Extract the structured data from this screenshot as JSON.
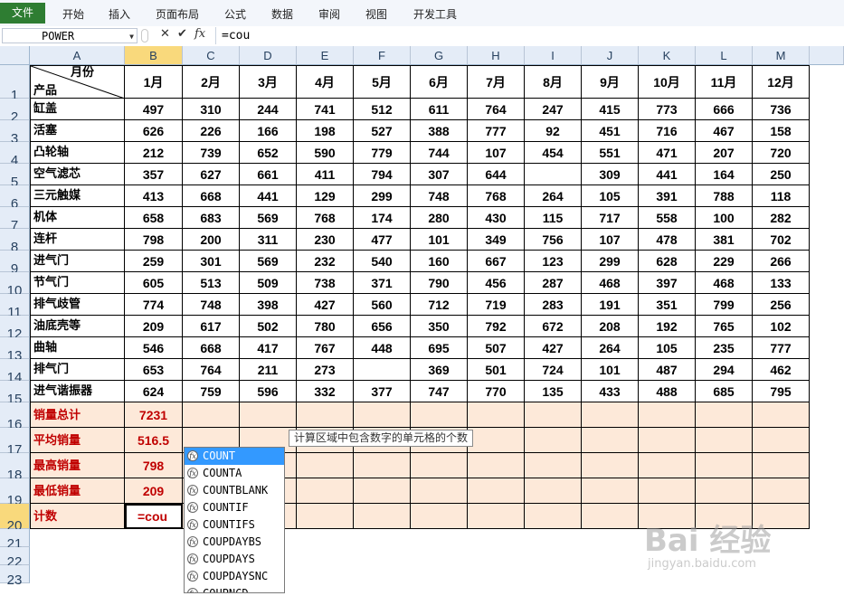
{
  "ribbon": {
    "file_tab": "文件",
    "tabs": [
      "开始",
      "插入",
      "页面布局",
      "公式",
      "数据",
      "审阅",
      "视图",
      "开发工具"
    ]
  },
  "formula_bar": {
    "name_box": "POWER",
    "cancel_symbol": "✕",
    "enter_symbol": "✔",
    "fx_symbol": "fx",
    "formula": "=cou"
  },
  "sheet": {
    "col_letters": [
      "A",
      "B",
      "C",
      "D",
      "E",
      "F",
      "G",
      "H",
      "I",
      "J",
      "K",
      "L",
      "M"
    ],
    "header_corner_top": "月份",
    "header_corner_bottom": "产品",
    "months": [
      "1月",
      "2月",
      "3月",
      "4月",
      "5月",
      "6月",
      "7月",
      "8月",
      "9月",
      "10月",
      "11月",
      "12月"
    ],
    "products": [
      {
        "name": "缸盖",
        "values": [
          "497",
          "310",
          "244",
          "741",
          "512",
          "611",
          "764",
          "247",
          "415",
          "773",
          "666",
          "736"
        ]
      },
      {
        "name": "活塞",
        "values": [
          "626",
          "226",
          "166",
          "198",
          "527",
          "388",
          "777",
          "92",
          "451",
          "716",
          "467",
          "158"
        ]
      },
      {
        "name": "凸轮轴",
        "values": [
          "212",
          "739",
          "652",
          "590",
          "779",
          "744",
          "107",
          "454",
          "551",
          "471",
          "207",
          "720"
        ]
      },
      {
        "name": "空气滤芯",
        "values": [
          "357",
          "627",
          "661",
          "411",
          "794",
          "307",
          "644",
          "",
          "309",
          "441",
          "164",
          "250"
        ]
      },
      {
        "name": "三元触媒",
        "values": [
          "413",
          "668",
          "441",
          "129",
          "299",
          "748",
          "768",
          "264",
          "105",
          "391",
          "788",
          "118"
        ]
      },
      {
        "name": "机体",
        "values": [
          "658",
          "683",
          "569",
          "768",
          "174",
          "280",
          "430",
          "115",
          "717",
          "558",
          "100",
          "282"
        ]
      },
      {
        "name": "连杆",
        "values": [
          "798",
          "200",
          "311",
          "230",
          "477",
          "101",
          "349",
          "756",
          "107",
          "478",
          "381",
          "702"
        ]
      },
      {
        "name": "进气门",
        "values": [
          "259",
          "301",
          "569",
          "232",
          "540",
          "160",
          "667",
          "123",
          "299",
          "628",
          "229",
          "266"
        ]
      },
      {
        "name": "节气门",
        "values": [
          "605",
          "513",
          "509",
          "738",
          "371",
          "790",
          "456",
          "287",
          "468",
          "397",
          "468",
          "133"
        ]
      },
      {
        "name": "排气歧管",
        "values": [
          "774",
          "748",
          "398",
          "427",
          "560",
          "712",
          "719",
          "283",
          "191",
          "351",
          "799",
          "256"
        ]
      },
      {
        "name": "油底壳等",
        "values": [
          "209",
          "617",
          "502",
          "780",
          "656",
          "350",
          "792",
          "672",
          "208",
          "192",
          "765",
          "102"
        ]
      },
      {
        "name": "曲轴",
        "values": [
          "546",
          "668",
          "417",
          "767",
          "448",
          "695",
          "507",
          "427",
          "264",
          "105",
          "235",
          "777"
        ]
      },
      {
        "name": "排气门",
        "values": [
          "653",
          "764",
          "211",
          "273",
          "",
          "369",
          "501",
          "724",
          "101",
          "487",
          "294",
          "462"
        ]
      },
      {
        "name": "进气谐振器",
        "values": [
          "624",
          "759",
          "596",
          "332",
          "377",
          "747",
          "770",
          "135",
          "433",
          "488",
          "685",
          "795"
        ]
      }
    ],
    "summary": [
      {
        "label": "销量总计",
        "value": "7231"
      },
      {
        "label": "平均销量",
        "value": "516.5"
      },
      {
        "label": "最高销量",
        "value": "798"
      },
      {
        "label": "最低销量",
        "value": "209"
      },
      {
        "label": "计数",
        "value": "=cou"
      }
    ]
  },
  "autocomplete": {
    "tooltip": "计算区域中包含数字的单元格的个数",
    "items": [
      "COUNT",
      "COUNTA",
      "COUNTBLANK",
      "COUNTIF",
      "COUNTIFS",
      "COUPDAYBS",
      "COUPDAYS",
      "COUPDAYSNC",
      "COUPNCD"
    ],
    "selected_index": 0
  },
  "watermark": {
    "brand": "Bai 经验",
    "url": "jingyan.baidu.com"
  },
  "colors": {
    "summary_fill": "#fde9d9",
    "summary_text": "#c00000",
    "header_selected": "#f9d97c",
    "file_tab": "#2e7d32",
    "autocomplete_highlight": "#3399ff"
  }
}
